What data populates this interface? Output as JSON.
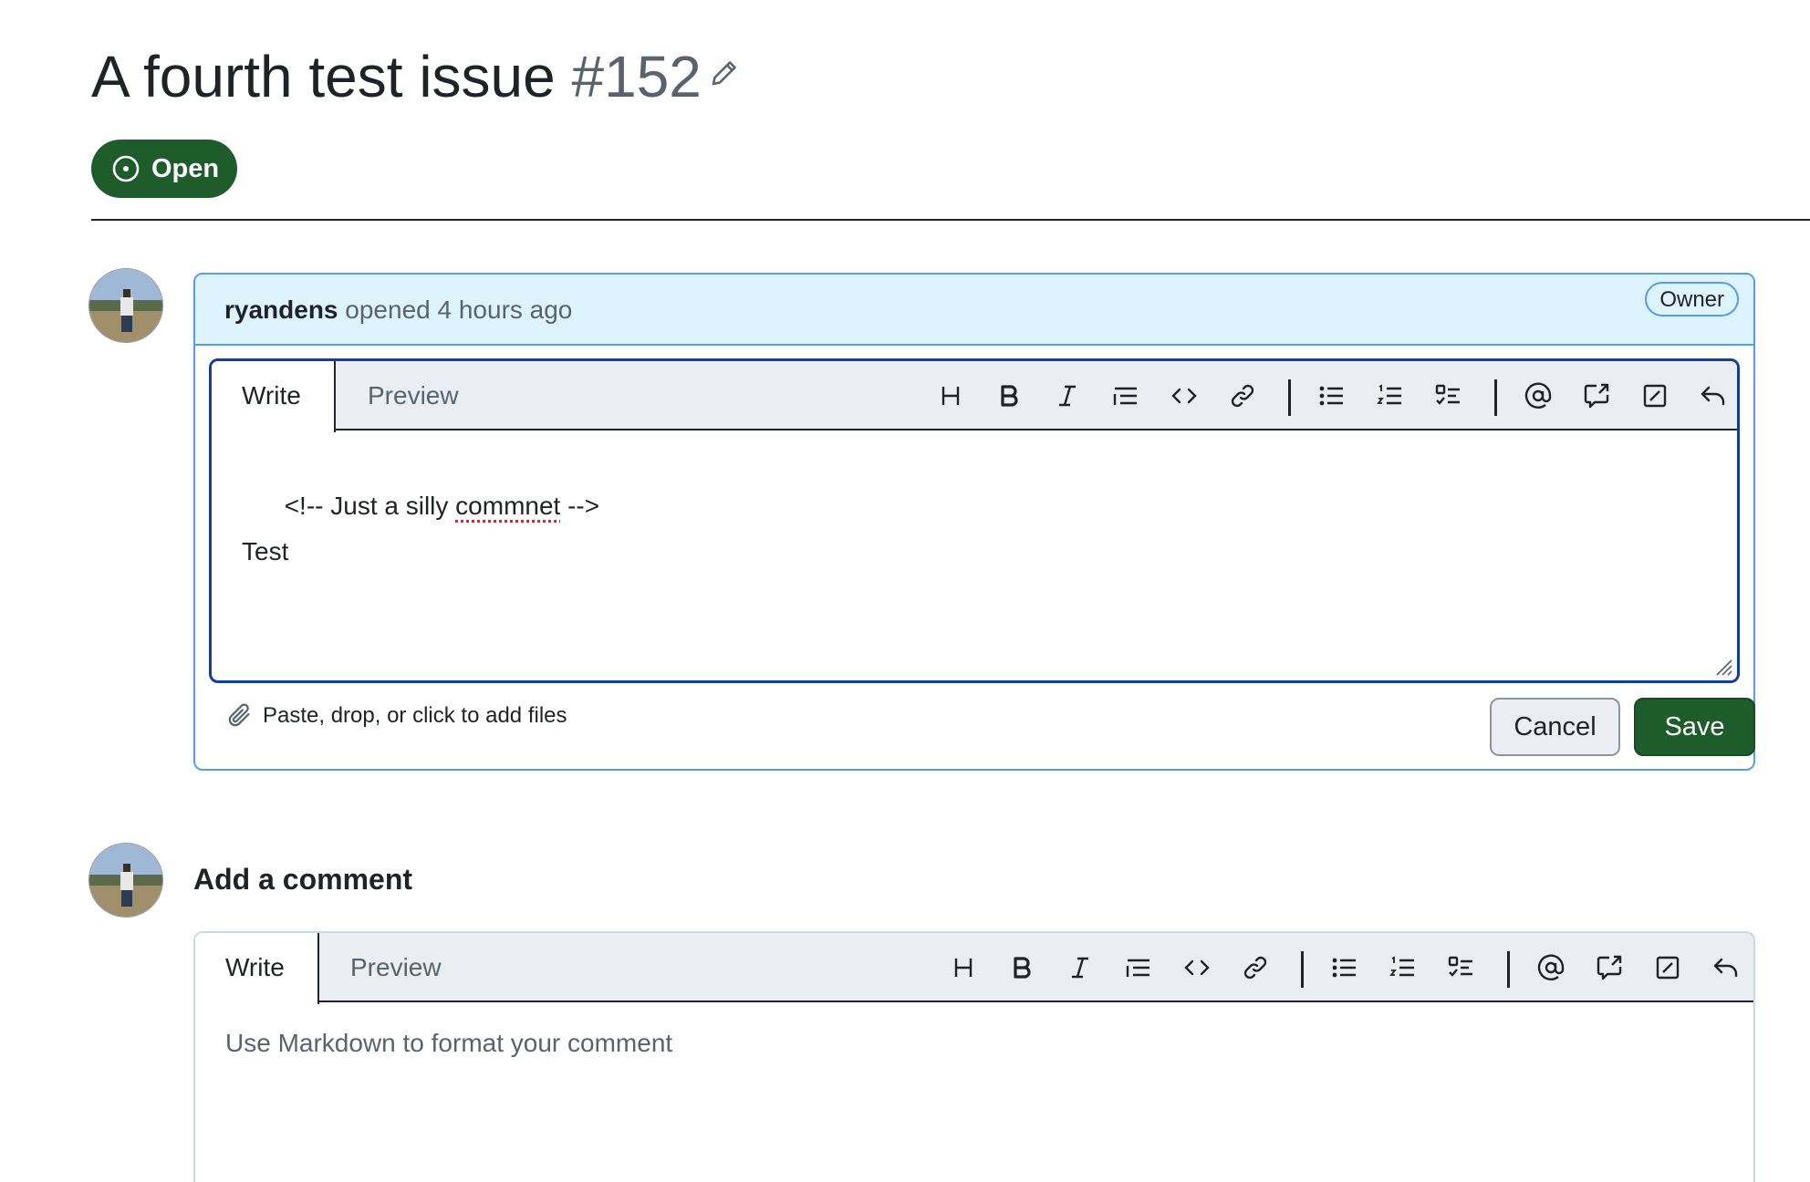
{
  "issue": {
    "title": "A fourth test issue",
    "number": "#152",
    "state": "Open"
  },
  "comment": {
    "author": "ryandens",
    "meta": "opened 4 hours ago",
    "role_badge": "Owner",
    "editor": {
      "tabs": [
        "Write",
        "Preview"
      ],
      "line1_prefix": "<!-- Just a silly ",
      "line1_misspelled": "commnet",
      "line1_suffix": " -->",
      "line2": "Test"
    },
    "attach_label": "Paste, drop, or click to add files",
    "cancel_label": "Cancel",
    "save_label": "Save"
  },
  "new_comment": {
    "heading": "Add a comment",
    "tabs": [
      "Write",
      "Preview"
    ],
    "placeholder": "Use Markdown to format your comment"
  },
  "toolbar_icons": [
    "heading-icon",
    "bold-icon",
    "italic-icon",
    "quote-icon",
    "code-icon",
    "link-icon",
    "unordered-list-icon",
    "ordered-list-icon",
    "task-list-icon",
    "mention-icon",
    "cross-reference-icon",
    "saved-replies-icon",
    "undo-icon"
  ],
  "colors": {
    "open_green": "#1f5c2c",
    "header_blue": "#ddf4ff",
    "focus_border": "#0e3fa1"
  }
}
